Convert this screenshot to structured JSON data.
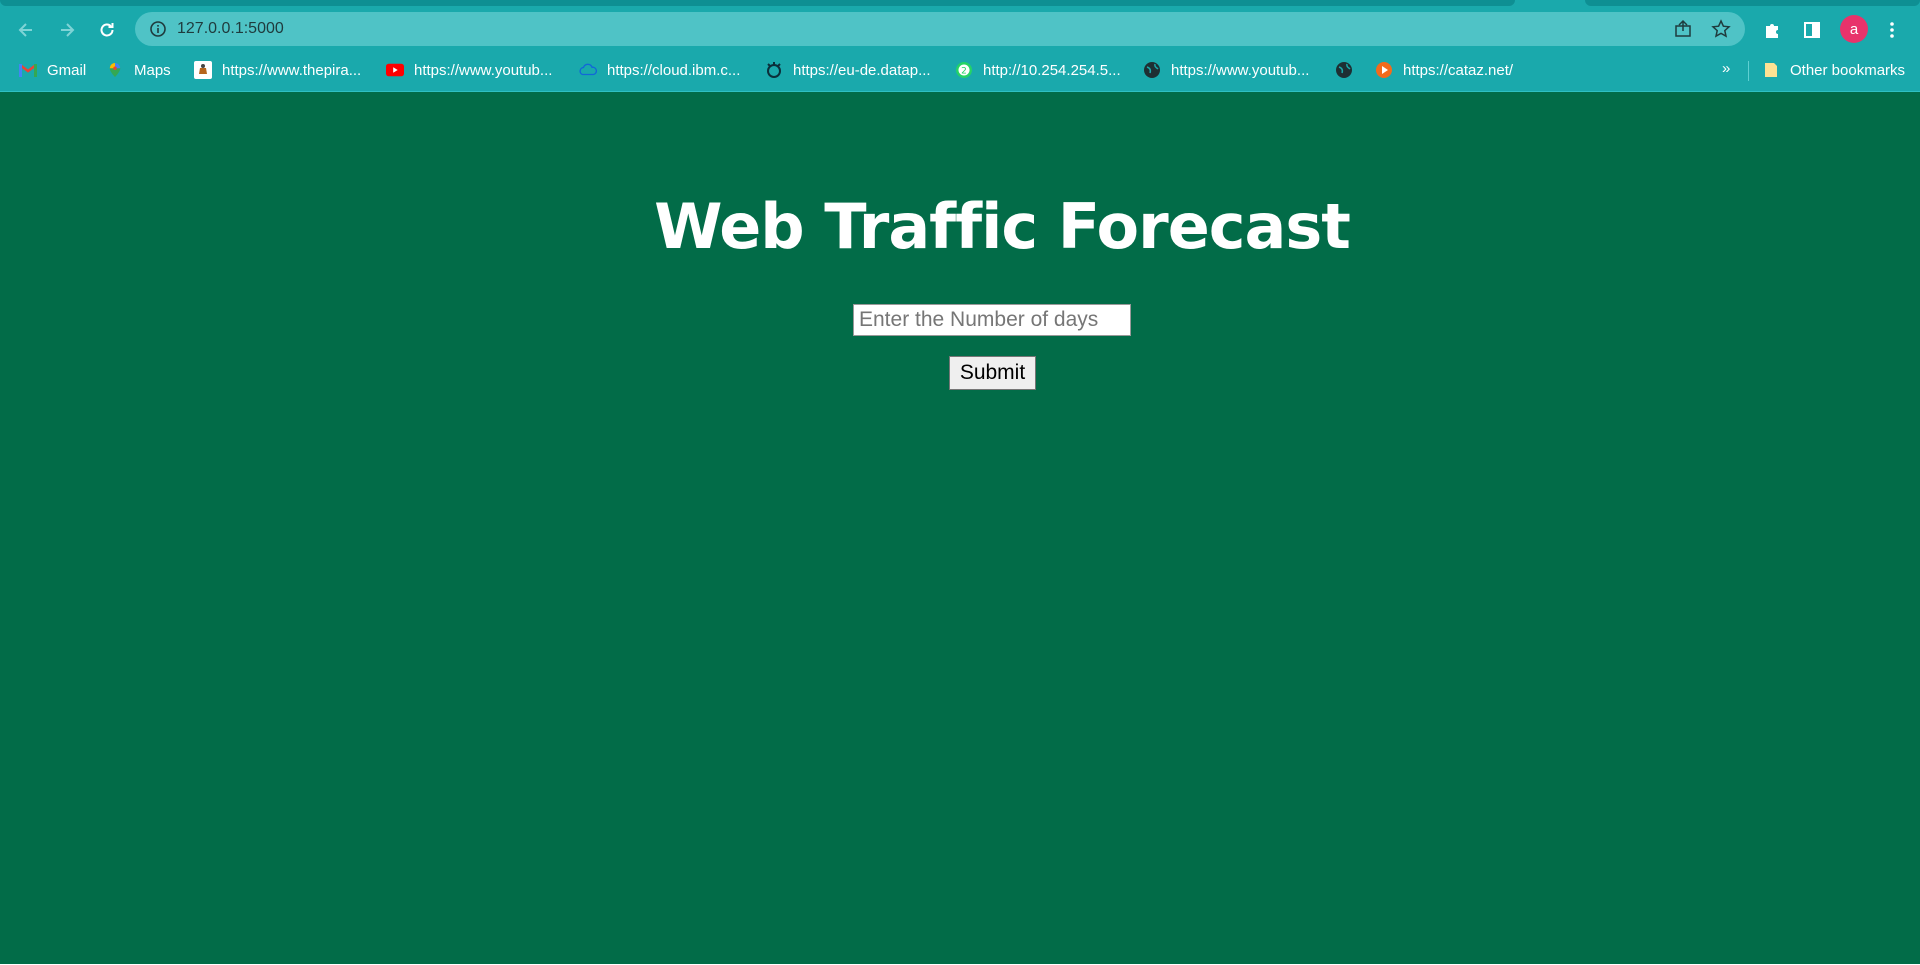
{
  "browser": {
    "url": "127.0.0.1:5000",
    "avatar_letter": "a",
    "bookmarks": [
      {
        "label": "Gmail",
        "icon": "gmail-icon"
      },
      {
        "label": "Maps",
        "icon": "maps-icon"
      },
      {
        "label": "https://www.thepira...",
        "icon": "pirate-icon"
      },
      {
        "label": "https://www.youtub...",
        "icon": "youtube-icon"
      },
      {
        "label": "https://cloud.ibm.c...",
        "icon": "ibm-cloud-icon"
      },
      {
        "label": "https://eu-de.datap...",
        "icon": "watson-icon"
      },
      {
        "label": "http://10.254.254.5...",
        "icon": "whatsapp-icon"
      },
      {
        "label": "https://www.youtub...",
        "icon": "globe-icon"
      },
      {
        "label": "",
        "icon": "globe-icon"
      },
      {
        "label": "https://cataz.net/",
        "icon": "play-icon"
      }
    ],
    "more_label": "»",
    "other_bookmarks": "Other bookmarks"
  },
  "page": {
    "title": "Web Traffic Forecast",
    "input_placeholder": "Enter the Number of days",
    "input_value": "",
    "submit_label": "Submit"
  },
  "colors": {
    "chrome": "#1aa9ac",
    "page_background": "#026c48",
    "title_text": "#ffffff"
  }
}
